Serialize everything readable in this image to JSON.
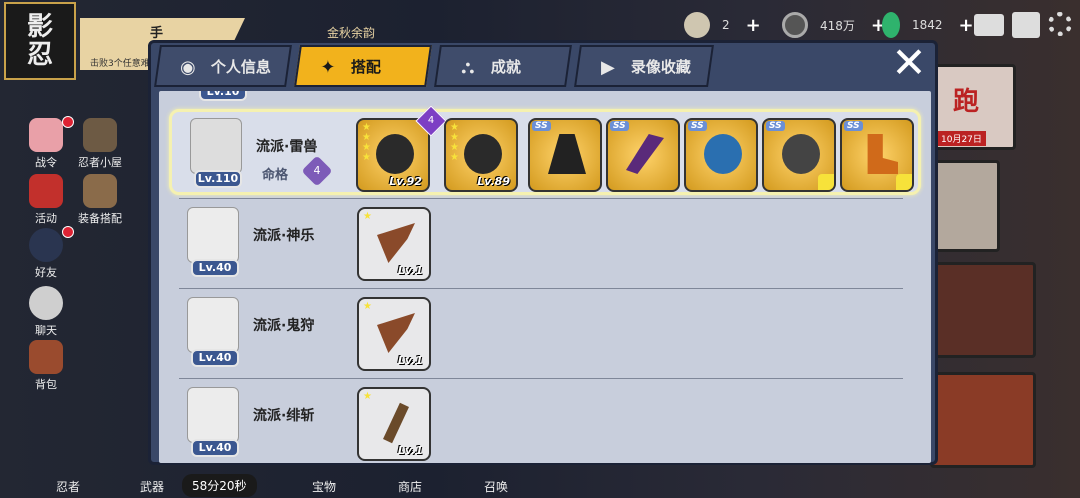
{
  "game": {
    "logo_line1": "影",
    "logo_line2": "忍"
  },
  "quest": {
    "title": "手",
    "desc": "击败3个任意难"
  },
  "event": {
    "label": "金秋余韵"
  },
  "resources": {
    "item1": "2",
    "coins": "418万",
    "gems": "1842"
  },
  "side_menu": [
    {
      "label": "战令"
    },
    {
      "label": "忍者小屋"
    },
    {
      "label": "活动"
    },
    {
      "label": "装备搭配"
    },
    {
      "label": "好友"
    },
    {
      "label": "聊天"
    },
    {
      "label": "背包"
    }
  ],
  "bottom_bar": {
    "ninja": "忍者",
    "weapon": "武器",
    "timer": "58分20秒",
    "treasure": "宝物",
    "shop": "商店",
    "summon": "召唤"
  },
  "banners": {
    "b1_text": "跑",
    "b1_date": "10月27日"
  },
  "tabs": [
    {
      "label": "个人信息",
      "icon": "ninja-icon"
    },
    {
      "label": "搭配",
      "icon": "shuriken-icon"
    },
    {
      "label": "成就",
      "icon": "trophy-icon"
    },
    {
      "label": "录像收藏",
      "icon": "play-icon"
    }
  ],
  "close_symbol": "✕",
  "partial_top_level": "Lv.10",
  "rows": [
    {
      "level": "Lv.110",
      "style_label": "流派·雷兽",
      "fate_label": "命格",
      "fate_value": "4",
      "items": [
        {
          "type": "gold",
          "lv": "Lv.92",
          "stars": 4,
          "badge": "4",
          "icon": "crossbow-icon"
        },
        {
          "type": "gold",
          "lv": "Lv.89",
          "stars": 4,
          "icon": "crossbow-icon"
        },
        {
          "type": "ss",
          "icon": "gauntlet-icon"
        },
        {
          "type": "ss",
          "icon": "blade-icon"
        },
        {
          "type": "ss",
          "icon": "orb-icon"
        },
        {
          "type": "ss",
          "icon": "bomb-icon",
          "corner": true
        },
        {
          "type": "ss",
          "icon": "boot-icon",
          "corner": true
        }
      ]
    },
    {
      "level": "Lv.40",
      "style_label": "流派·神乐",
      "items": [
        {
          "type": "plain",
          "lv": "Lv.1",
          "stars": 1,
          "icon": "umbrella-icon"
        }
      ]
    },
    {
      "level": "Lv.40",
      "style_label": "流派·鬼狩",
      "items": [
        {
          "type": "plain",
          "lv": "Lv.1",
          "stars": 1,
          "icon": "umbrella-icon"
        }
      ]
    },
    {
      "level": "Lv.40",
      "style_label": "流派·绯斩",
      "items": [
        {
          "type": "plain",
          "lv": "Lv.1",
          "stars": 1,
          "icon": "sword-icon"
        }
      ]
    }
  ]
}
